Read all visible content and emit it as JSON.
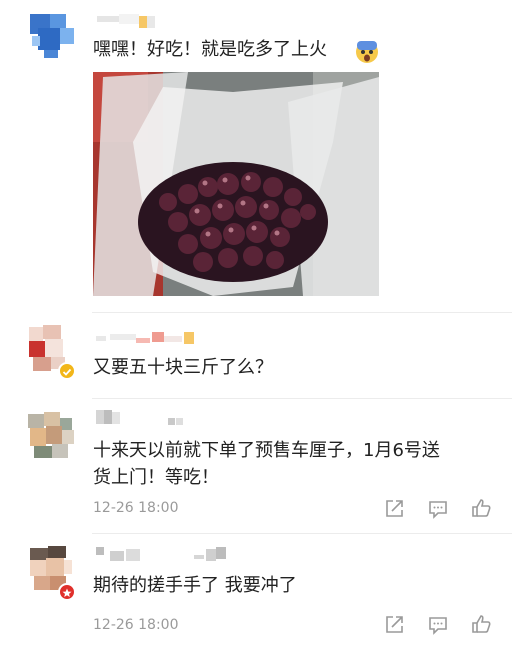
{
  "comments": [
    {
      "text": "嘿嘿！好吃！就是吃多了上火",
      "emoji": "scared-face-emoji"
    },
    {
      "text": "又要五十块三斤了么？",
      "badge": "verified-badge"
    },
    {
      "text_line1": "十来天以前就下单了预售车厘子，1月6号送",
      "text_line2": "货上门！等吃！",
      "timestamp": "12-26 18:00"
    },
    {
      "text": "期待的搓手手了 我要冲了",
      "timestamp": "12-26 18:00"
    }
  ],
  "icons": [
    "share-icon",
    "comment-icon",
    "like-icon"
  ],
  "colors": {
    "meta": "#9a9a9a",
    "divider": "#ececec",
    "badge_gold": "#f2b619",
    "badge_red": "#e0302b"
  }
}
